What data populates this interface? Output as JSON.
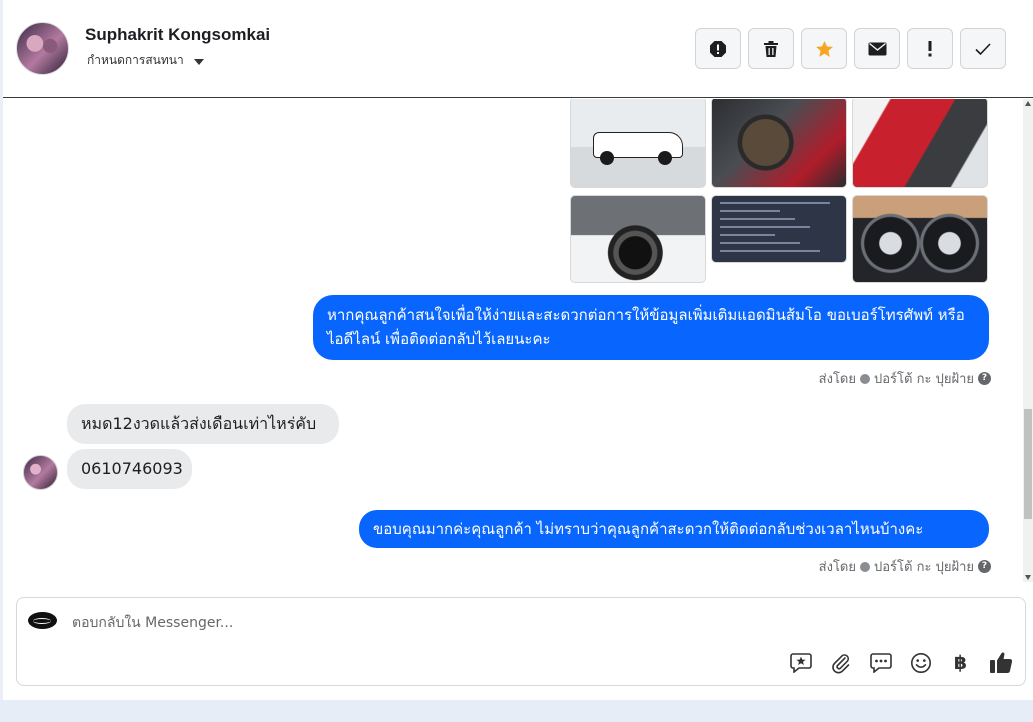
{
  "header": {
    "contact_name": "Suphakrit Kongsomkai",
    "assign_label": "กำหนดการสนทนา",
    "actions": [
      {
        "name": "report-icon",
        "label": "!"
      },
      {
        "name": "trash-icon"
      },
      {
        "name": "star-icon",
        "color": "#f5a623"
      },
      {
        "name": "mail-icon"
      },
      {
        "name": "exclamation-icon",
        "label": "!"
      },
      {
        "name": "check-icon"
      }
    ]
  },
  "messages": {
    "outgoing_1": "หากคุณลูกค้าสนใจเพื่อให้ง่ายและสะดวกต่อการให้ข้อมูลเพิ่มเติมแอดมินส้มโอ ขอเบอร์โทรศัพท์ หรือ ไอดีไลน์ เพื่อติดต่อกลับไว้เลยนะคะ",
    "sent_by_1": "ส่งโดย",
    "sender_1": "ปอร์โต้ กะ ปุยฝ้าย",
    "incoming_1": "หมด12งวดแล้วส่งเดือนเท่าไหร่คับ",
    "incoming_2": "0610746093",
    "outgoing_2": "ขอบคุณมากค่ะคุณลูกค้า ไม่ทราบว่าคุณลูกค้าสะดวกให้ติดต่อกลับช่วงเวลาไหนบ้างคะ",
    "sent_by_2": "ส่งโดย",
    "sender_2": "ปอร์โต้ กะ ปุยฝ้าย",
    "help_icon": "?"
  },
  "composer": {
    "placeholder": "ตอบกลับใน Messenger...",
    "baht_symbol": "฿"
  },
  "colors": {
    "outgoing_bubble": "#0866ff",
    "incoming_bubble": "#e9eaec",
    "star": "#f5a623"
  }
}
